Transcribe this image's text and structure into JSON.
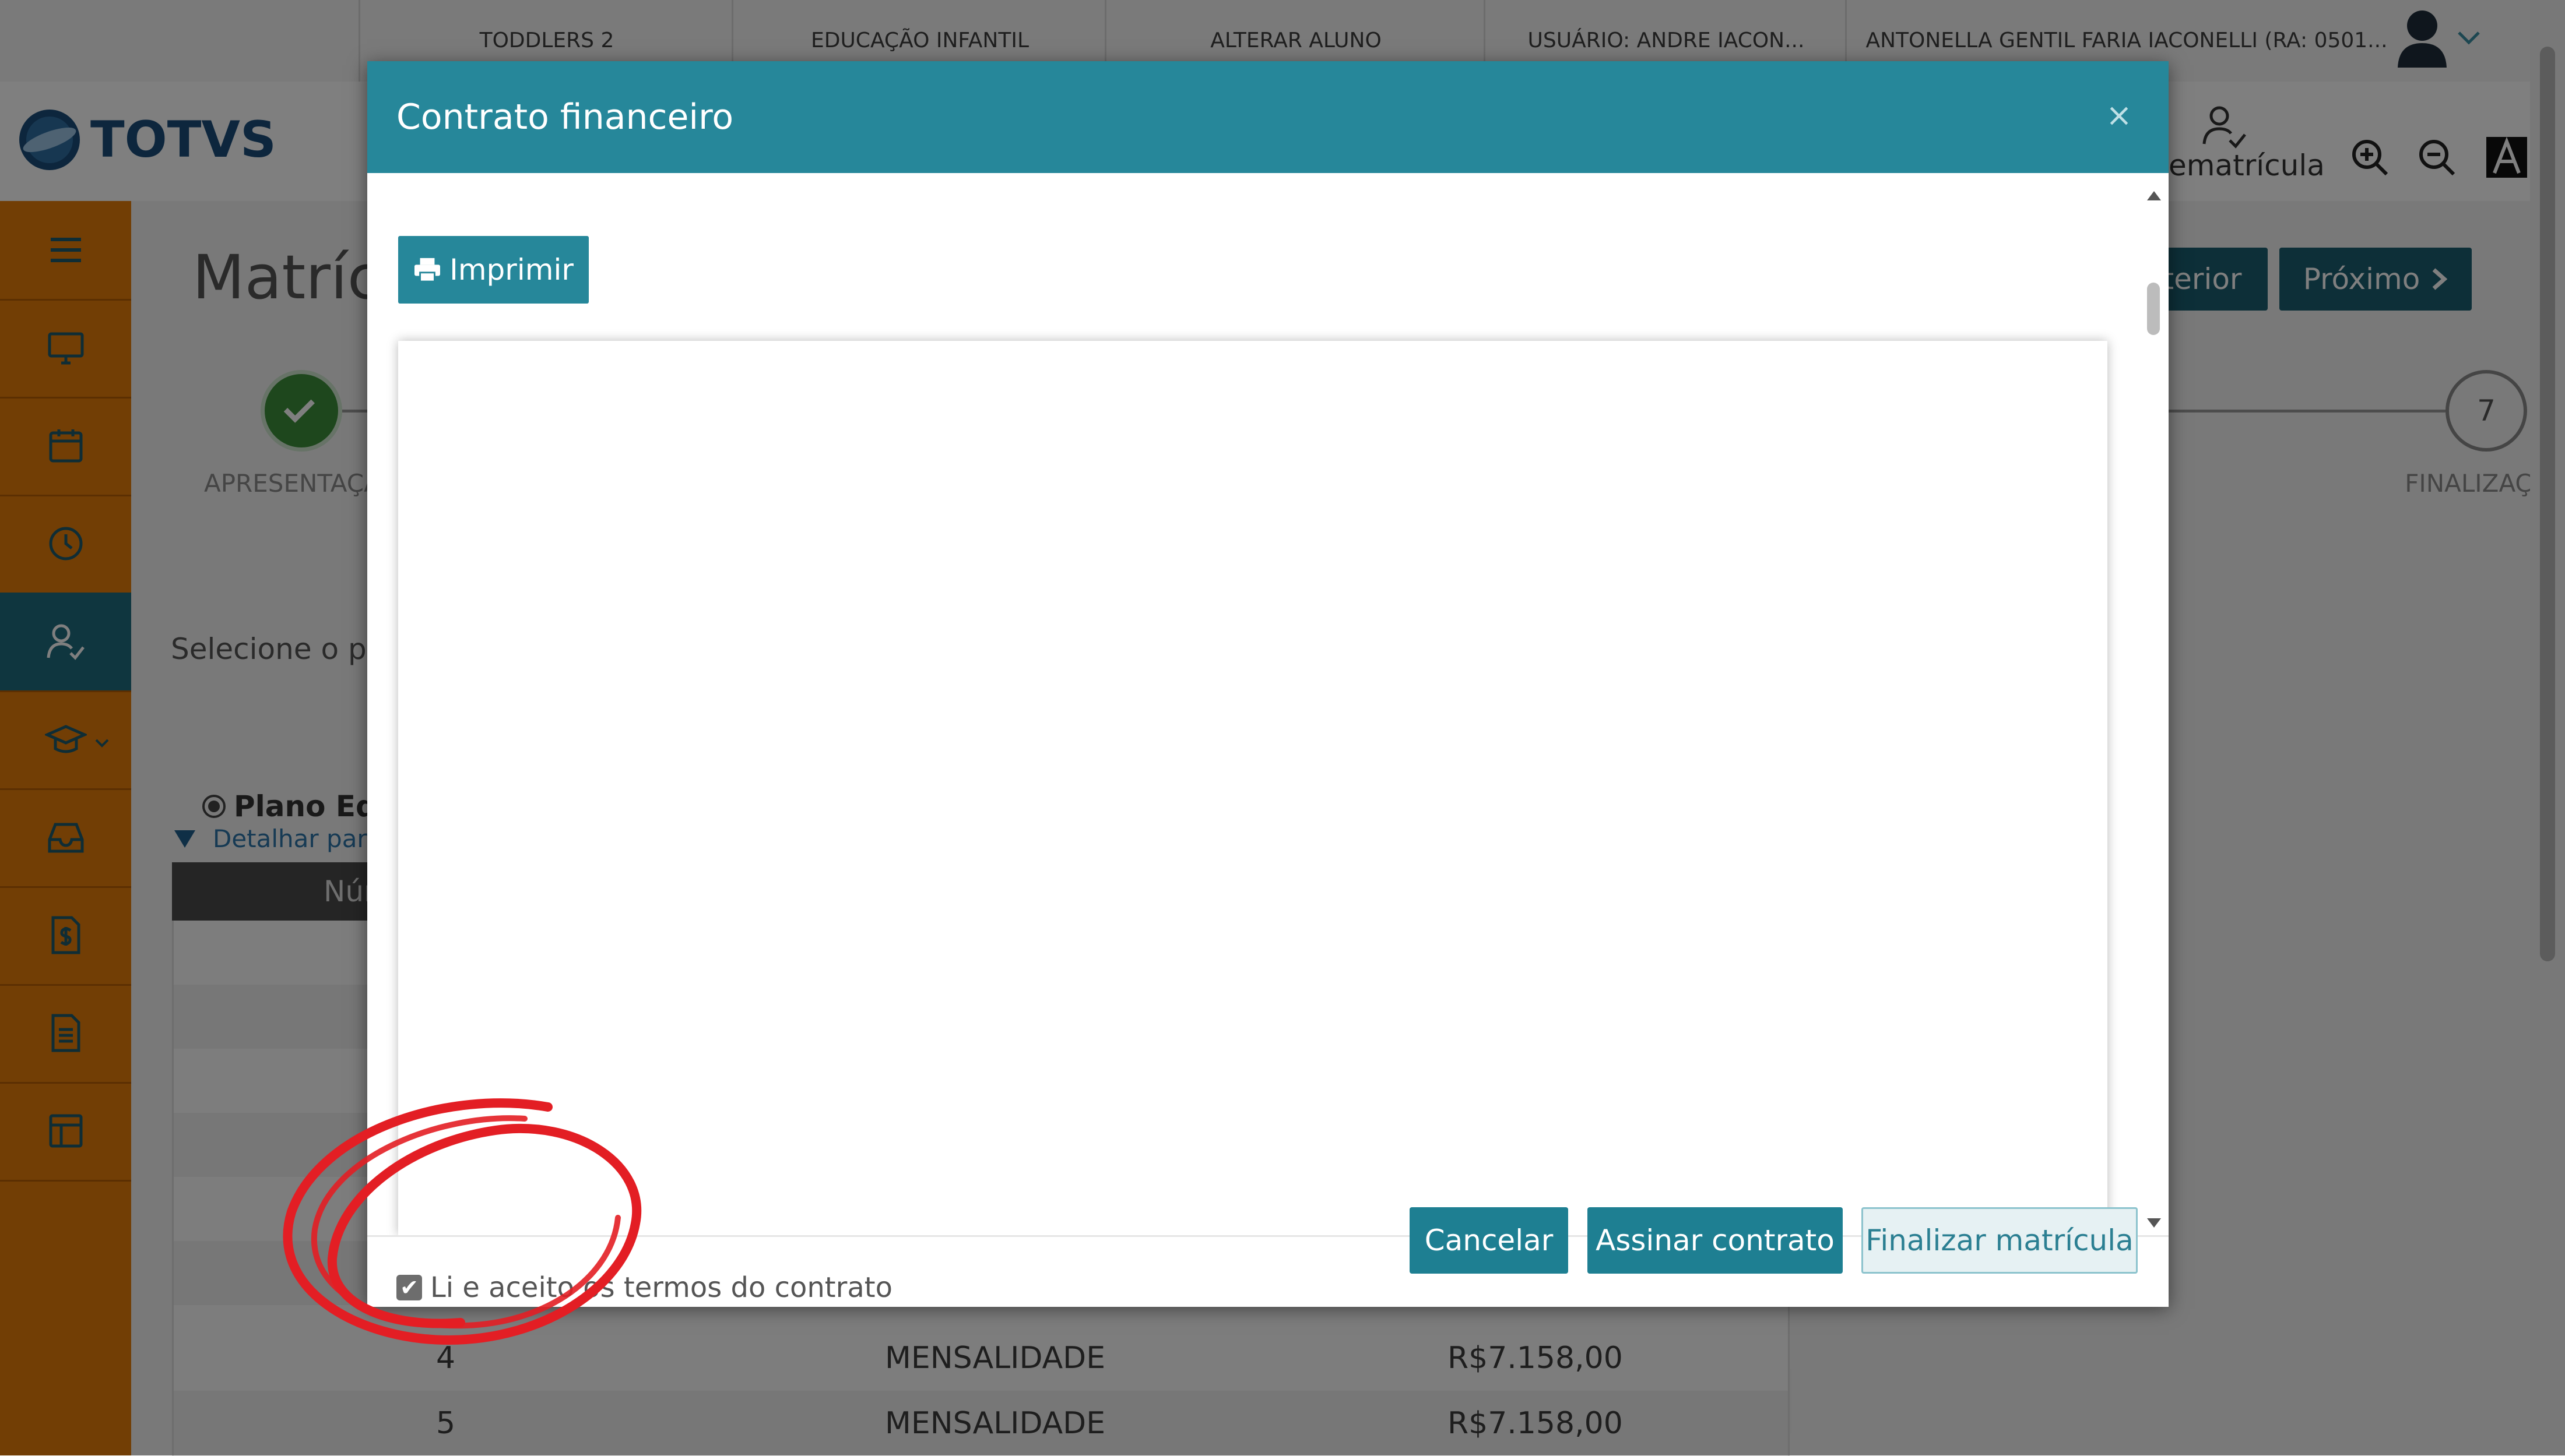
{
  "topbar": {
    "items": [
      "TODDLERS 2",
      "EDUCAÇÃO INFANTIL",
      "ALTERAR ALUNO",
      "USUÁRIO: ANDRE IACON...",
      "ANTONELLA GENTIL FARIA IACONELLI (RA: 0501..."
    ]
  },
  "header": {
    "logo_text": "TOTVS",
    "rematricula_label": "ematrícula"
  },
  "sidebar": {
    "items": [
      "menu-icon",
      "monitor-icon",
      "calendar-icon",
      "clock-icon",
      "user-check-icon",
      "graduation-cap-icon",
      "inbox-icon",
      "invoice-icon",
      "document-icon",
      "layout-icon"
    ],
    "active_index": 4
  },
  "page": {
    "title": "Matríc",
    "btn_prev": "terior",
    "btn_next": "Próximo",
    "step1_label": "APRESENTAÇÃ",
    "step7_number": "7",
    "step7_label": "FINALIZAÇÃO",
    "select_plan_text": "Selecione o plar",
    "plan_radio_label": "Plano Educ",
    "detail_link": "Detalhar parce",
    "table_header_num": "Nún",
    "rows": [
      {
        "num": "4",
        "desc": "MENSALIDADE",
        "value": "R$7.158,00"
      },
      {
        "num": "5",
        "desc": "MENSALIDADE",
        "value": "R$7.158,00"
      }
    ]
  },
  "modal": {
    "title": "Contrato financeiro",
    "close": "×",
    "print_label": "Imprimir",
    "accept_label": "Li e aceito os termos do contrato",
    "accept_checked": true,
    "cancel_label": "Cancelar",
    "sign_label": "Assinar contrato",
    "finish_label": "Finalizar matrícula"
  },
  "colors": {
    "teal": "#26879a",
    "dark_teal": "#1b5e70",
    "orange": "#e57d0b",
    "annotation_red": "#e31e24"
  }
}
